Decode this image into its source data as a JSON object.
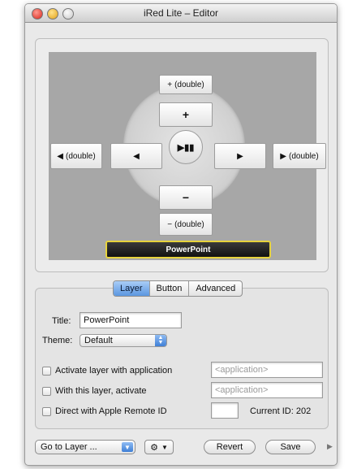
{
  "window": {
    "title": "iRed Lite – Editor"
  },
  "remote": {
    "up_double_label": "(double)",
    "left_double_label": "(double)",
    "right_double_label": "(double)",
    "down_double_label": "(double)",
    "up_label": "+",
    "down_label": "−",
    "left_icon": "◀",
    "right_icon": "▶",
    "play_pause_icon": "▶▮▮",
    "layer_name": "PowerPoint"
  },
  "tabs": [
    {
      "label": "Layer",
      "active": true
    },
    {
      "label": "Button",
      "active": false
    },
    {
      "label": "Advanced",
      "active": false
    }
  ],
  "layer": {
    "title_label": "Title:",
    "title_value": "PowerPoint",
    "theme_label": "Theme:",
    "theme_value": "Default",
    "activate_with_app_label": "Activate layer with application",
    "activate_with_app_placeholder": "<application>",
    "with_layer_activate_label": "With this layer, activate",
    "with_layer_activate_placeholder": "<application>",
    "direct_remote_label": "Direct with Apple Remote ID",
    "current_id_label": "Current ID: 202"
  },
  "footer": {
    "goto_label": "Go to Layer ...",
    "revert_label": "Revert",
    "save_label": "Save"
  },
  "colors": {
    "accent_blue": "#5b96e0",
    "layer_highlight": "#e7d33c"
  }
}
